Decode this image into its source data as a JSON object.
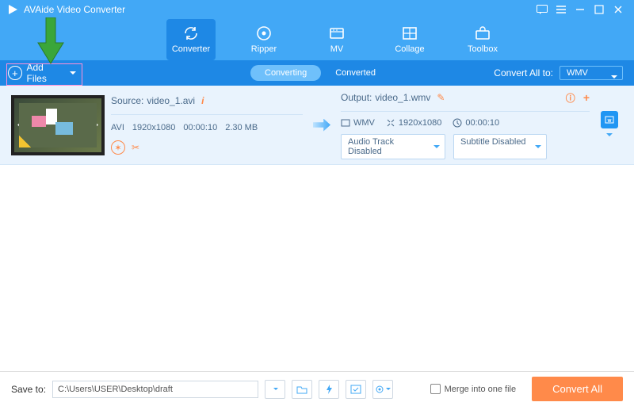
{
  "app": {
    "title": "AVAide Video Converter"
  },
  "nav": [
    {
      "label": "Converter",
      "icon": "converter"
    },
    {
      "label": "Ripper",
      "icon": "ripper"
    },
    {
      "label": "MV",
      "icon": "mv"
    },
    {
      "label": "Collage",
      "icon": "collage"
    },
    {
      "label": "Toolbox",
      "icon": "toolbox"
    }
  ],
  "toolbar": {
    "add_files": "Add Files",
    "tabs": {
      "converting": "Converting",
      "converted": "Converted"
    },
    "convert_all_label": "Convert All to:",
    "convert_all_format": "WMV"
  },
  "file": {
    "source_label": "Source:",
    "source_name": "video_1.avi",
    "src_fmt": "AVI",
    "src_res": "1920x1080",
    "src_dur": "00:00:10",
    "src_size": "2.30 MB",
    "output_label": "Output:",
    "output_name": "video_1.wmv",
    "out_fmt": "WMV",
    "out_res": "1920x1080",
    "out_dur": "00:00:10",
    "audio_track": "Audio Track Disabled",
    "subtitle": "Subtitle Disabled",
    "badge": "WMV"
  },
  "footer": {
    "save_to_label": "Save to:",
    "save_path": "C:\\Users\\USER\\Desktop\\draft",
    "merge_label": "Merge into one file",
    "convert_btn": "Convert All"
  }
}
